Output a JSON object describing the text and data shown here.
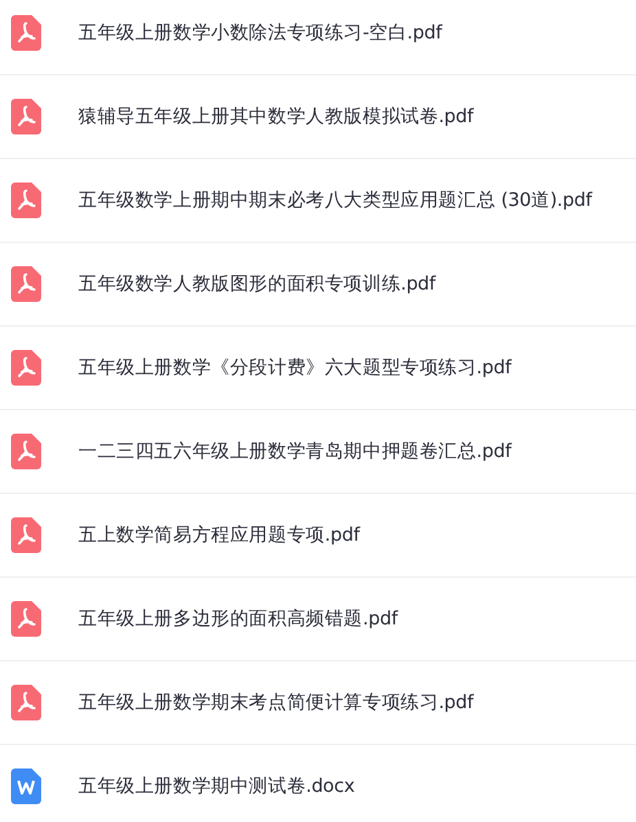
{
  "files": [
    {
      "kind": "pdf",
      "name": "五年级上册数学小数除法专项练习-空白.pdf"
    },
    {
      "kind": "pdf",
      "name": "猿辅导五年级上册其中数学人教版模拟试卷.pdf"
    },
    {
      "kind": "pdf",
      "name": "五年级数学上册期中期末必考八大类型应用题汇总 (30道).pdf"
    },
    {
      "kind": "pdf",
      "name": "五年级数学人教版图形的面积专项训练.pdf"
    },
    {
      "kind": "pdf",
      "name": "五年级上册数学《分段计费》六大题型专项练习.pdf"
    },
    {
      "kind": "pdf",
      "name": "一二三四五六年级上册数学青岛期中押题卷汇总.pdf"
    },
    {
      "kind": "pdf",
      "name": "五上数学简易方程应用题专项.pdf"
    },
    {
      "kind": "pdf",
      "name": "五年级上册多边形的面积高频错题.pdf"
    },
    {
      "kind": "pdf",
      "name": "五年级上册数学期末考点简便计算专项练习.pdf"
    },
    {
      "kind": "docx",
      "name": "五年级上册数学期中测试卷.docx"
    }
  ]
}
